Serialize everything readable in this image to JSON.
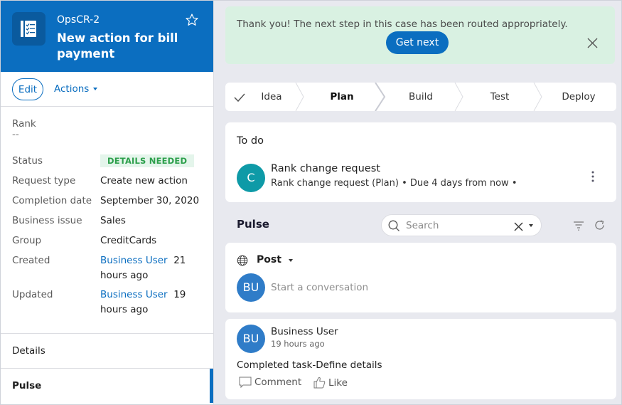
{
  "case": {
    "id": "OpsCR-2",
    "title": "New action for bill payment",
    "icon": "case-checklist-icon",
    "favorite_icon": "star-icon"
  },
  "toolbar": {
    "edit_label": "Edit",
    "actions_label": "Actions"
  },
  "summary": {
    "rank": {
      "label": "Rank",
      "value": "--"
    },
    "fields": [
      {
        "label": "Status",
        "value": "DETAILS NEEDED",
        "type": "badge"
      },
      {
        "label": "Request type",
        "value": "Create new action"
      },
      {
        "label": "Completion date",
        "value": "September 30, 2020"
      },
      {
        "label": "Business issue",
        "value": "Sales"
      },
      {
        "label": "Group",
        "value": "CreditCards"
      },
      {
        "label": "Created",
        "user": "Business User",
        "time": "21 hours ago"
      },
      {
        "label": "Updated",
        "user": "Business User",
        "time": "19 hours ago"
      }
    ]
  },
  "nav": {
    "items": [
      {
        "label": "Details",
        "active": false
      },
      {
        "label": "Pulse",
        "active": true
      }
    ]
  },
  "banner": {
    "message": "Thank you! The next step in this case has been routed appropriately.",
    "button_label": "Get next",
    "close_icon": "close-icon"
  },
  "stages": {
    "items": [
      {
        "label": "Idea",
        "state": "completed"
      },
      {
        "label": "Plan",
        "state": "current"
      },
      {
        "label": "Build",
        "state": "future"
      },
      {
        "label": "Test",
        "state": "future"
      },
      {
        "label": "Deploy",
        "state": "future"
      }
    ]
  },
  "todo": {
    "title": "To do",
    "item": {
      "avatar": "C",
      "name": "Rank change request",
      "meta": "Rank change request (Plan) • Due 4 days from now •"
    }
  },
  "pulse": {
    "title": "Pulse",
    "search_placeholder": "Search",
    "search_value": "",
    "post": {
      "scope_label": "Post",
      "avatar": "BU",
      "placeholder": "Start a conversation"
    },
    "feed": [
      {
        "avatar": "BU",
        "author": "Business User",
        "time": "19 hours ago",
        "body": "Completed task-Define details",
        "comment_label": "Comment",
        "like_label": "Like"
      }
    ]
  },
  "colors": {
    "brand": "#0b6ec0",
    "banner_bg": "#d9f1e2",
    "status_badge_text": "#2c9f4b",
    "status_badge_bg": "#e4f5eb",
    "todo_avatar": "#0e9aa7",
    "user_avatar": "#2f7cc8"
  }
}
